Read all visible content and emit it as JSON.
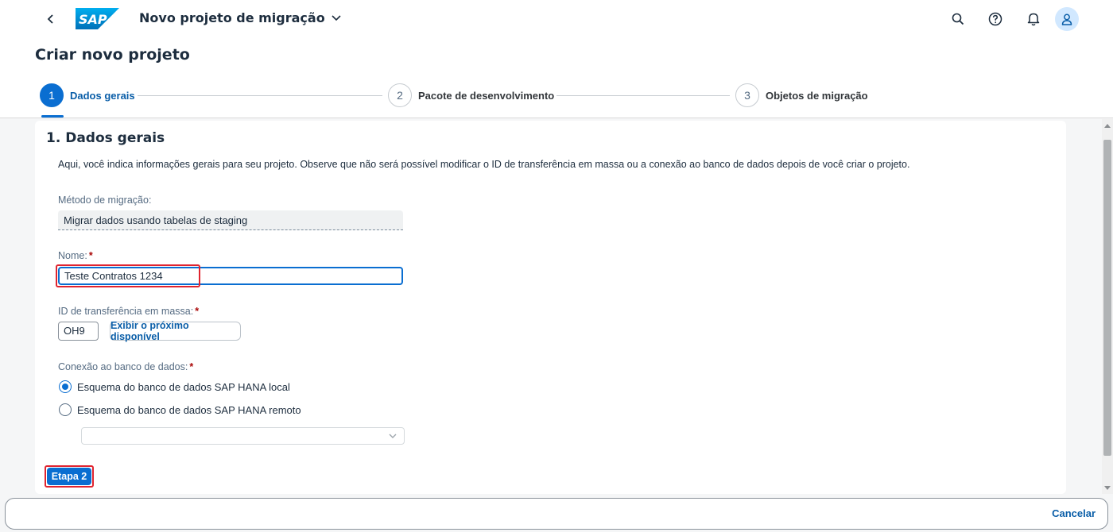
{
  "shell": {
    "app_title": "Novo projeto de migração",
    "logo_text": "SAP",
    "icons": [
      "back-icon",
      "search-icon",
      "help-icon",
      "notification-bell-icon",
      "user-icon"
    ]
  },
  "page": {
    "title": "Criar novo projeto",
    "steps": [
      {
        "number": "1",
        "label": "Dados gerais",
        "active": true
      },
      {
        "number": "2",
        "label": "Pacote de desenvolvimento",
        "active": false
      },
      {
        "number": "3",
        "label": "Objetos de migração",
        "active": false
      }
    ]
  },
  "section": {
    "title": "1. Dados gerais",
    "intro": "Aqui, você indica informações gerais para seu projeto. Observe que não será possível modificar o ID de transferência em massa ou a conexão ao banco de dados depois de você criar o projeto."
  },
  "form": {
    "migration_method": {
      "label": "Método de migração:",
      "value": "Migrar dados usando tabelas de staging"
    },
    "name": {
      "label": "Nome:",
      "required_mark": "*",
      "value": "Teste Contratos 1234"
    },
    "mass_transfer_id": {
      "label": "ID de transferência em massa:",
      "required_mark": "*",
      "value": "OH9",
      "button_label": "Exibir o próximo disponível"
    },
    "db_connection": {
      "label": "Conexão ao banco de dados:",
      "required_mark": "*",
      "options": [
        {
          "label": "Esquema do banco de dados SAP HANA local",
          "selected": true
        },
        {
          "label": "Esquema do banco de dados SAP HANA remoto",
          "selected": false
        }
      ],
      "remote_select_value": ""
    },
    "next_button": "Etapa 2"
  },
  "footer": {
    "cancel_label": "Cancelar"
  },
  "colors": {
    "accent": "#0a6ed1",
    "highlight": "#e0242f",
    "required": "#aa0808"
  }
}
